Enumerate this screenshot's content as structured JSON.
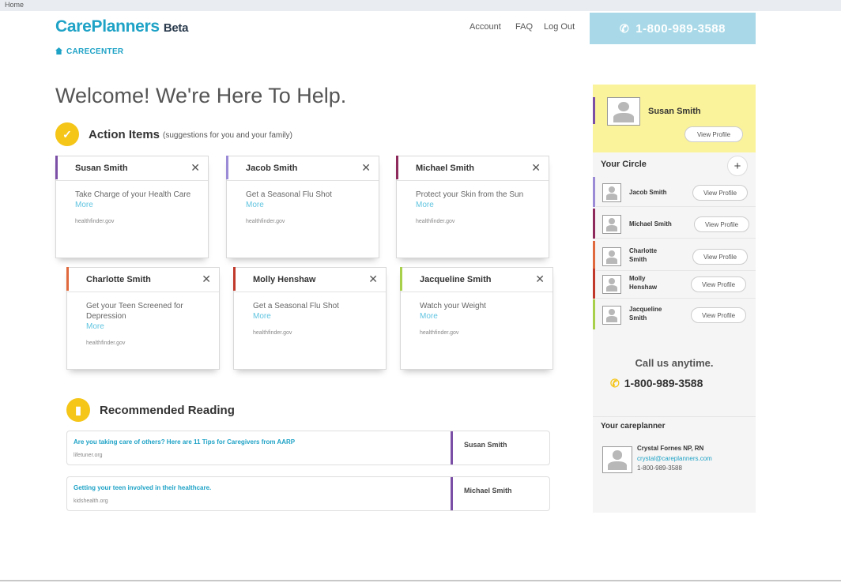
{
  "browser": {
    "tab_label": "Home"
  },
  "header": {
    "logo": "CarePlanners",
    "beta": "Beta",
    "nav": [
      {
        "label": "Account"
      },
      {
        "label": "FAQ"
      },
      {
        "label": "Log Out"
      }
    ],
    "phone": "1-800-989-3588"
  },
  "breadcrumb": "CARECENTER",
  "welcome": "Welcome! We're Here To Help.",
  "action_items": {
    "title": "Action Items",
    "subtitle": "(suggestions for you and your family)",
    "cards": [
      {
        "name": "Susan Smith",
        "task": "Take Charge of your Health Care",
        "more": "More",
        "source": "healthfinder.gov",
        "color": "#7b4fa6"
      },
      {
        "name": "Jacob Smith",
        "task": "Get a Seasonal Flu Shot",
        "more": "More",
        "source": "healthfinder.gov",
        "color": "#9b8ad6"
      },
      {
        "name": "Michael Smith",
        "task": "Protect your Skin from the Sun",
        "more": "More",
        "source": "healthfinder.gov",
        "color": "#8e2a5c"
      },
      {
        "name": "Charlotte Smith",
        "task": "Get your Teen Screened for Depression",
        "more": "More",
        "source": "healthfinder.gov",
        "color": "#e06a3d"
      },
      {
        "name": "Molly Henshaw",
        "task": "Get a Seasonal Flu Shot",
        "more": "More",
        "source": "healthfinder.gov",
        "color": "#c0392b"
      },
      {
        "name": "Jacqueline Smith",
        "task": "Watch your Weight",
        "more": "More",
        "source": "healthfinder.gov",
        "color": "#a8d04a"
      }
    ]
  },
  "reading": {
    "title": "Recommended Reading",
    "items": [
      {
        "title": "Are you taking care of others? Here are 11 Tips for Caregivers from AARP",
        "source": "lifetuner.org",
        "person": "Susan Smith"
      },
      {
        "title": "Getting your teen involved in their healthcare.",
        "source": "kidshealth.org",
        "person": "Michael Smith"
      }
    ]
  },
  "sidebar": {
    "profile": {
      "name": "Susan Smith",
      "button": "View Profile"
    },
    "circle_title": "Your Circle",
    "add": "+",
    "members": [
      {
        "name": "Jacob Smith",
        "button": "View Profile",
        "color": "#9b8ad6"
      },
      {
        "name": "Michael Smith",
        "button": "View Profile",
        "color": "#8e2a5c"
      },
      {
        "name": "Charlotte Smith",
        "button": "View Profile",
        "color": "#e06a3d"
      },
      {
        "name": "Molly Henshaw",
        "button": "View Profile",
        "color": "#c0392b"
      },
      {
        "name": "Jacqueline Smith",
        "button": "View Profile",
        "color": "#a8d04a"
      }
    ],
    "call_us": "Call us anytime.",
    "call_phone": "1-800-989-3588",
    "careplanner": {
      "title": "Your careplanner",
      "name": "Crystal Fornes NP, RN",
      "email": "crystal@careplanners.com",
      "phone": "1-800-989-3588"
    }
  }
}
